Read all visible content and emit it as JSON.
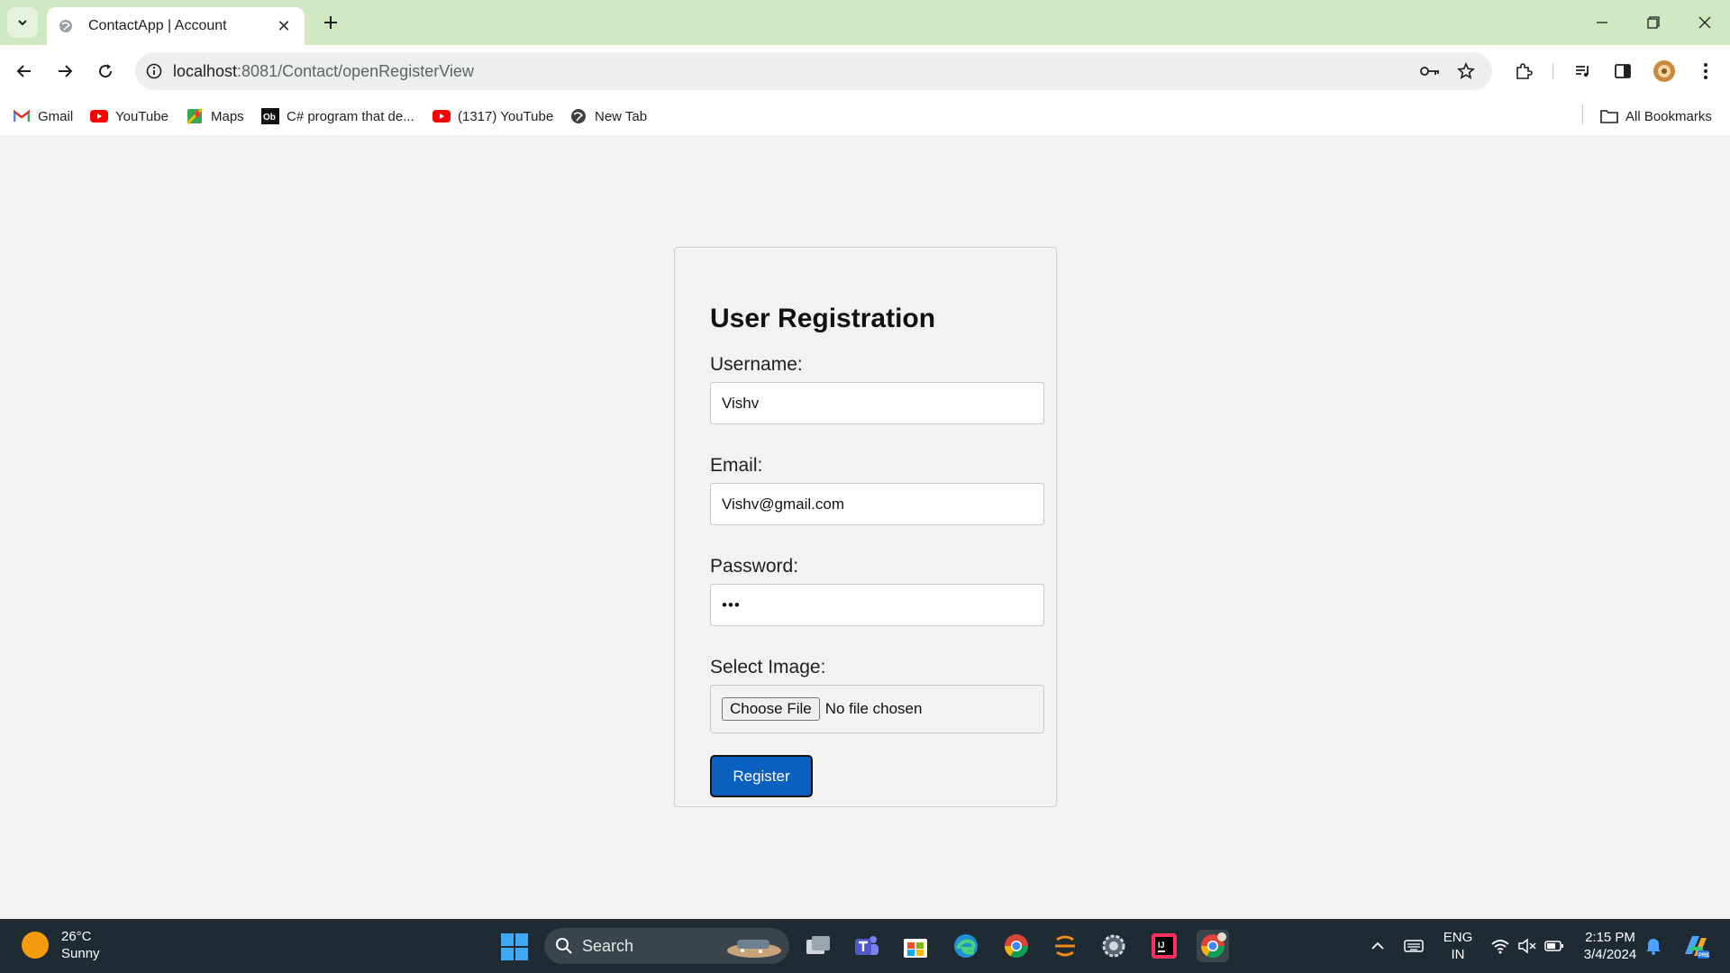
{
  "browser": {
    "tab": {
      "title": "ContactApp | Account"
    },
    "address": {
      "host": "localhost",
      "rest": ":8081/Contact/openRegisterView"
    },
    "bookmarks": [
      {
        "label": "Gmail",
        "icon": "gmail-icon"
      },
      {
        "label": "YouTube",
        "icon": "youtube-icon"
      },
      {
        "label": "Maps",
        "icon": "maps-icon"
      },
      {
        "label": "C# program that de...",
        "icon": "ob-icon"
      },
      {
        "label": "(1317) YouTube",
        "icon": "youtube-icon"
      },
      {
        "label": "New Tab",
        "icon": "globe-icon"
      }
    ],
    "all_bookmarks_label": "All Bookmarks"
  },
  "form": {
    "title": "User Registration",
    "username": {
      "label": "Username:",
      "value": "Vishv"
    },
    "email": {
      "label": "Email:",
      "value": "Vishv@gmail.com"
    },
    "password": {
      "label": "Password:",
      "value": "•••"
    },
    "image": {
      "label": "Select Image:",
      "button": "Choose File",
      "status": "No file chosen"
    },
    "submit_label": "Register"
  },
  "taskbar": {
    "weather": {
      "temp": "26°C",
      "condition": "Sunny"
    },
    "search_label": "Search",
    "language": {
      "line1": "ENG",
      "line2": "IN"
    },
    "clock": {
      "time": "2:15 PM",
      "date": "3/4/2024"
    }
  },
  "colors": {
    "tabstrip": "#cfe8c2",
    "primary_button": "#0a5fbf",
    "taskbar": "#1f2b33"
  }
}
